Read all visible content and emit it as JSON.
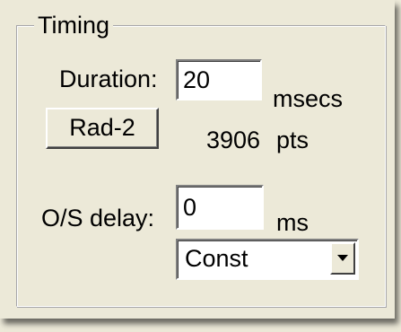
{
  "timing": {
    "group_title": "Timing",
    "duration_label": "Duration:",
    "duration_value": "20",
    "duration_unit": "msecs",
    "rad_button_label": "Rad-2",
    "points_value": "3906",
    "points_unit": "pts",
    "os_delay_label": "O/S delay:",
    "os_delay_value": "0",
    "os_delay_unit": "ms",
    "mode_selected": "Const"
  },
  "icons": {
    "dropdown_arrow": "chevron-down-icon"
  }
}
